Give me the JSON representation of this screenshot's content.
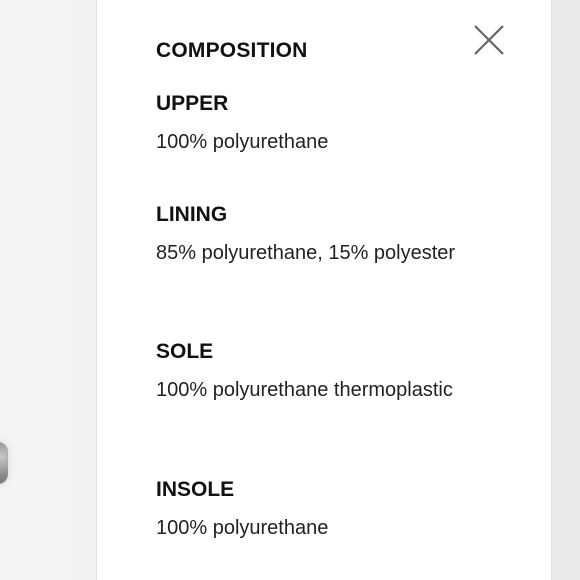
{
  "panel": {
    "title": "COMPOSITION",
    "close_icon": "close-icon",
    "sections": [
      {
        "heading": "UPPER",
        "text": "100% polyurethane"
      },
      {
        "heading": "LINING",
        "text": "85% polyurethane, 15% polyester"
      },
      {
        "heading": "SOLE",
        "text": "100% polyurethane thermoplastic"
      },
      {
        "heading": "INSOLE",
        "text": "100% polyurethane"
      }
    ]
  },
  "colors": {
    "text": "#111111",
    "panel_bg": "#ffffff",
    "page_bg": "#f2f2f2",
    "icon": "#666666"
  }
}
